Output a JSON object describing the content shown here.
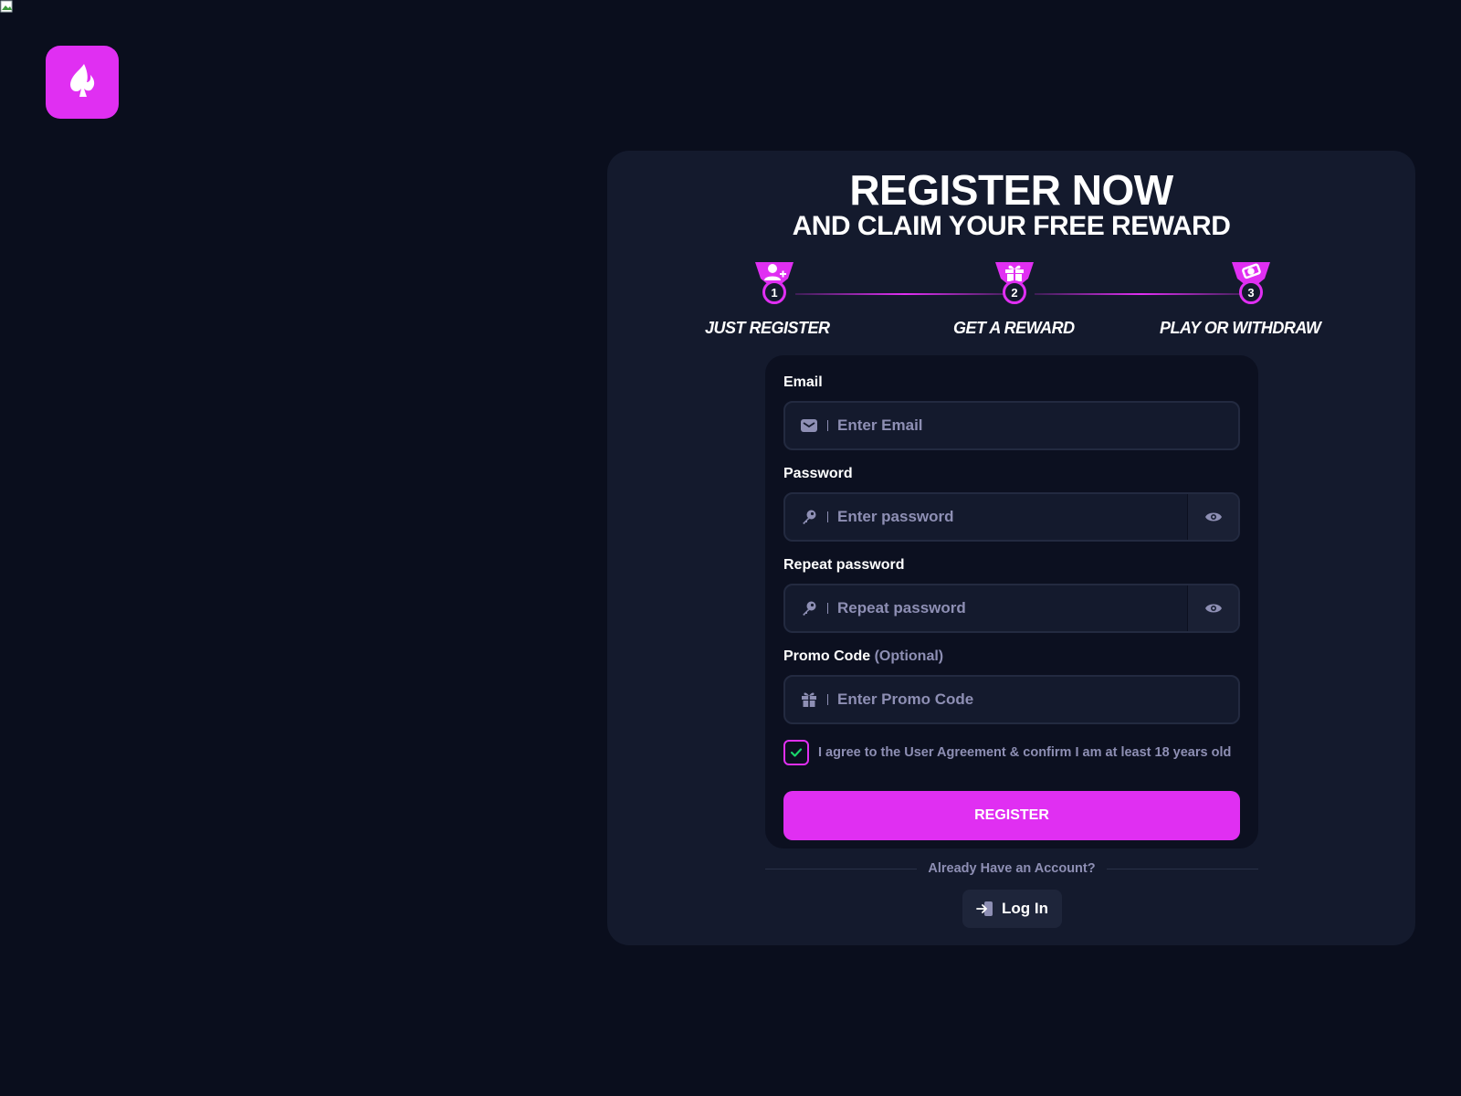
{
  "header": {
    "title": "REGISTER NOW",
    "subtitle": "AND CLAIM YOUR FREE REWARD"
  },
  "steps": [
    {
      "number": "1",
      "label": "JUST REGISTER",
      "icon": "user-plus-icon"
    },
    {
      "number": "2",
      "label": "GET A REWARD",
      "icon": "gift-icon"
    },
    {
      "number": "3",
      "label": "PLAY OR WITHDRAW",
      "icon": "money-icon"
    }
  ],
  "form": {
    "email_label": "Email",
    "email_placeholder": "Enter Email",
    "password_label": "Password",
    "password_placeholder": "Enter password",
    "repeat_label": "Repeat password",
    "repeat_placeholder": "Repeat password",
    "promo_label": "Promo Code",
    "promo_optional": "(Optional)",
    "promo_placeholder": "Enter Promo Code",
    "agree_text": "I agree to the User Agreement & confirm I am at least 18 years old",
    "agree_checked": true,
    "register_label": "REGISTER"
  },
  "footer": {
    "already_text": "Already Have an Account?",
    "login_label": "Log In"
  },
  "colors": {
    "accent": "#e02ff2",
    "background": "#0a0e1d",
    "panel": "#141a2d",
    "muted": "#8e8fb4",
    "check": "#19d66b"
  }
}
